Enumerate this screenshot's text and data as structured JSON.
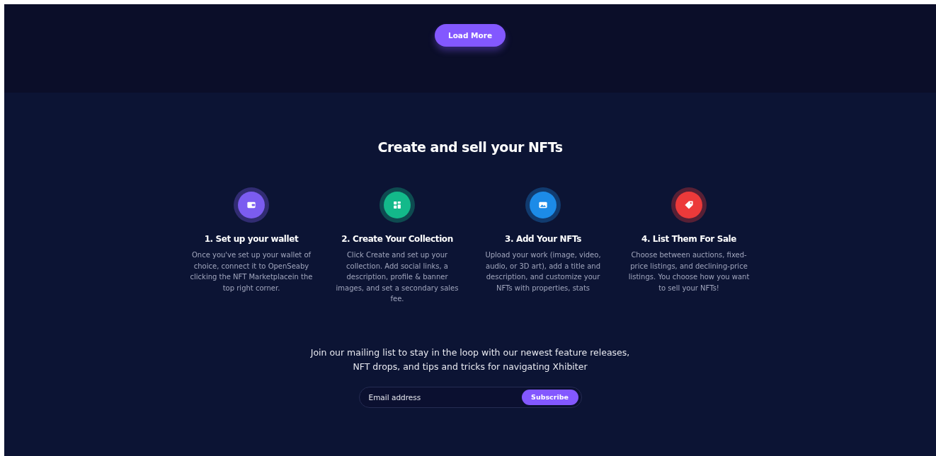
{
  "load_more": {
    "label": "Load More"
  },
  "section": {
    "title": "Create and sell your NFTs"
  },
  "steps": [
    {
      "color": "#7b5cf0",
      "title": "1. Set up your wallet",
      "text": "Once you've set up your wallet of choice, connect it to OpenSeaby clicking the NFT Marketplacein the top right corner."
    },
    {
      "color": "#13b98a",
      "title": "2. Create Your Collection",
      "text": "Click Create and set up your collection. Add social links, a description, profile & banner images, and set a secondary sales fee."
    },
    {
      "color": "#1c8be8",
      "title": "3. Add Your NFTs",
      "text": "Upload your work (image, video, audio, or 3D art), add a title and description, and customize your NFTs with properties, stats"
    },
    {
      "color": "#ec3a3a",
      "title": "4. List Them For Sale",
      "text": "Choose between auctions, fixed-price listings, and declining-price listings. You choose how you want to sell your NFTs!"
    }
  ],
  "newsletter": {
    "text": "Join our mailing list to stay in the loop with our newest feature releases, NFT drops, and tips and tricks for navigating Xhibiter",
    "placeholder": "Email address",
    "button": "Subscribe"
  }
}
